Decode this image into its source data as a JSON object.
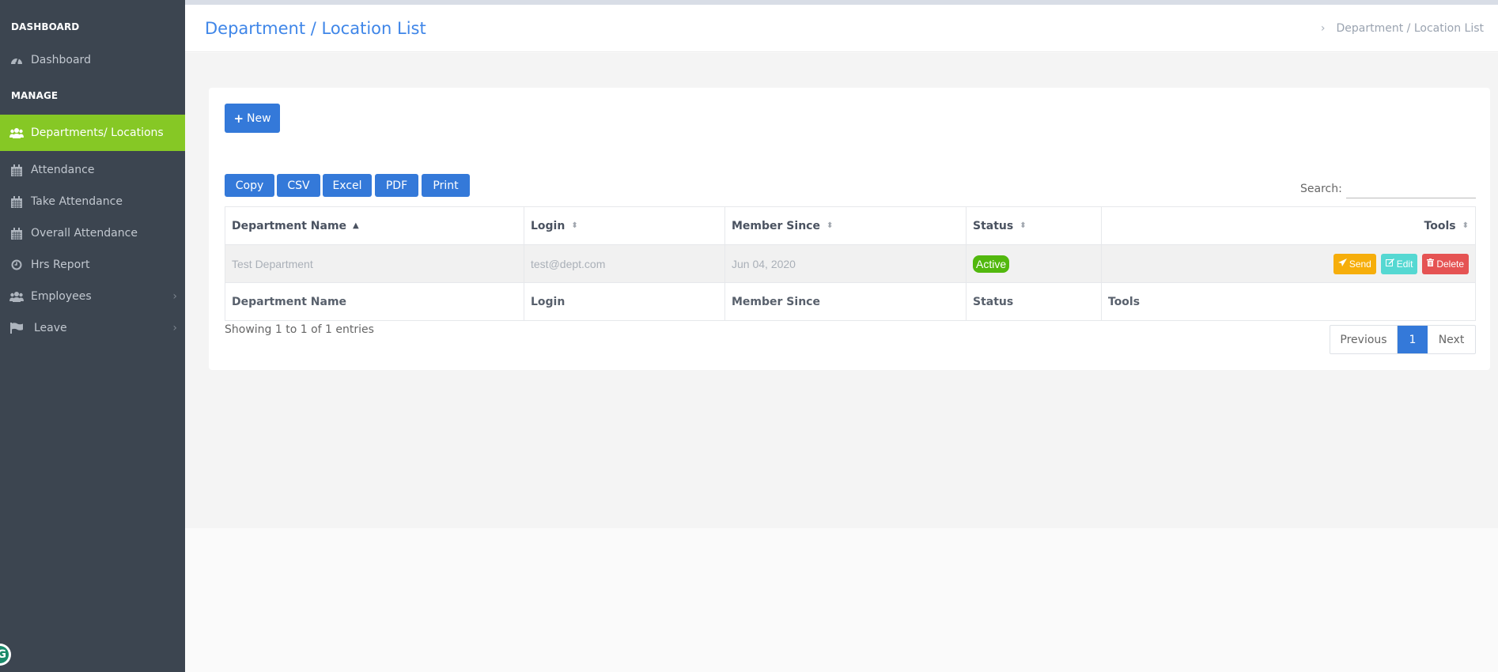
{
  "sidebar": {
    "heading_dashboard": "DASHBOARD",
    "heading_manage": "MANAGE",
    "items": [
      {
        "label": "Dashboard",
        "icon": "dashboard-gauge-icon"
      },
      {
        "label": "Departments/ Locations",
        "icon": "users-group-icon",
        "active": true
      },
      {
        "label": "Attendance",
        "icon": "calendar-icon"
      },
      {
        "label": "Take Attendance",
        "icon": "calendar-icon"
      },
      {
        "label": "Overall Attendance",
        "icon": "calendar-icon"
      },
      {
        "label": "Hrs Report",
        "icon": "clock-icon"
      },
      {
        "label": "Employees",
        "icon": "users-group-icon",
        "has_submenu": true
      },
      {
        "label": "Leave",
        "icon": "flag-icon",
        "has_submenu": true
      }
    ],
    "chevron": "›",
    "accent_color": "#86c825",
    "background": "#3c4550"
  },
  "header": {
    "title": "Department / Location List",
    "breadcrumb_separator": "›",
    "breadcrumb": "Department / Location List"
  },
  "toolbar": {
    "new_label": "New",
    "new_icon": "+",
    "export_buttons": [
      "Copy",
      "CSV",
      "Excel",
      "PDF",
      "Print"
    ]
  },
  "search": {
    "label": "Search:",
    "value": "",
    "placeholder": ""
  },
  "table": {
    "columns": [
      "Department Name",
      "Login",
      "Member Since",
      "Status",
      "Tools"
    ],
    "sorted_column": "Department Name",
    "sort_direction": "asc",
    "rows": [
      {
        "department_name": "Test Department",
        "login": "test@dept.com",
        "member_since": "Jun 04, 2020",
        "status": "Active",
        "tools": {
          "send": "Send",
          "edit": "Edit",
          "delete": "Delete"
        }
      }
    ],
    "footer_columns": [
      "Department Name",
      "Login",
      "Member Since",
      "Status",
      "Tools"
    ]
  },
  "pagination": {
    "info": "Showing 1 to 1 of 1 entries",
    "previous": "Previous",
    "current_page": "1",
    "next": "Next"
  },
  "colors": {
    "primary": "#3479d9",
    "title": "#3f86e8",
    "status_active": "#52b80e",
    "send": "#f6ae0b",
    "edit": "#55d8d2",
    "delete": "#e55353"
  }
}
